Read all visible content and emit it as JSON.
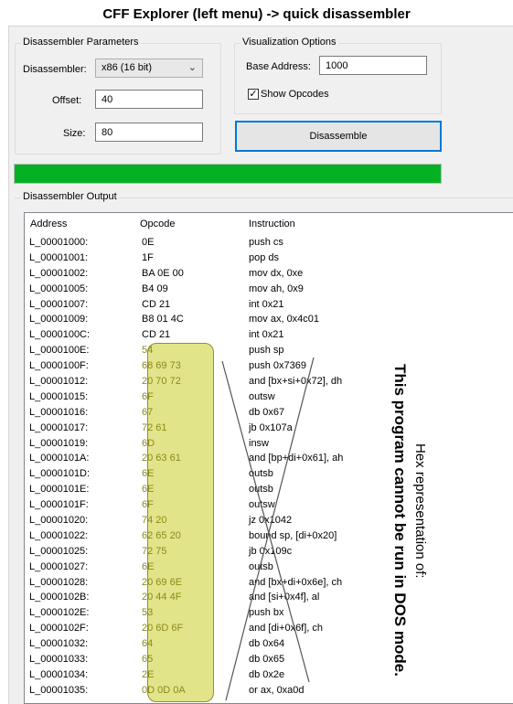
{
  "banner": "CFF Explorer (left menu) -> quick disassembler",
  "disassembler_params": {
    "title": "Disassembler Parameters",
    "disassembler_label": "Disassembler:",
    "disassembler_value": "x86 (16 bit)",
    "offset_label": "Offset:",
    "offset_value": "40",
    "size_label": "Size:",
    "size_value": "80"
  },
  "visualization": {
    "title": "Visualization Options",
    "base_address_label": "Base Address:",
    "base_address_value": "1000",
    "show_opcodes_label": "Show Opcodes",
    "show_opcodes_checked": true
  },
  "disassemble_button": "Disassemble",
  "progress_percent": 100,
  "output": {
    "title": "Disassembler Output",
    "columns": [
      "Address",
      "Opcode",
      "Instruction"
    ],
    "rows": [
      {
        "addr": "L_00001000:",
        "op": "0E",
        "ins": "push cs",
        "hi": false
      },
      {
        "addr": "L_00001001:",
        "op": "1F",
        "ins": "pop ds",
        "hi": false
      },
      {
        "addr": "L_00001002:",
        "op": "BA 0E 00",
        "ins": "mov dx, 0xe",
        "hi": false
      },
      {
        "addr": "L_00001005:",
        "op": "B4 09",
        "ins": "mov ah, 0x9",
        "hi": false
      },
      {
        "addr": "L_00001007:",
        "op": "CD 21",
        "ins": "int 0x21",
        "hi": false
      },
      {
        "addr": "L_00001009:",
        "op": "B8 01 4C",
        "ins": "mov ax, 0x4c01",
        "hi": false
      },
      {
        "addr": "L_0000100C:",
        "op": "CD 21",
        "ins": "int 0x21",
        "hi": false
      },
      {
        "addr": "L_0000100E:",
        "op": "54",
        "ins": "push sp",
        "hi": true
      },
      {
        "addr": "L_0000100F:",
        "op": "68 69 73",
        "ins": "push 0x7369",
        "hi": true
      },
      {
        "addr": "L_00001012:",
        "op": "20 70 72",
        "ins": "and [bx+si+0x72], dh",
        "hi": true
      },
      {
        "addr": "L_00001015:",
        "op": "6F",
        "ins": "outsw",
        "hi": true
      },
      {
        "addr": "L_00001016:",
        "op": "67",
        "ins": "db 0x67",
        "hi": true
      },
      {
        "addr": "L_00001017:",
        "op": "72 61",
        "ins": "jb 0x107a",
        "hi": true
      },
      {
        "addr": "L_00001019:",
        "op": "6D",
        "ins": "insw",
        "hi": true
      },
      {
        "addr": "L_0000101A:",
        "op": "20 63 61",
        "ins": "and [bp+di+0x61], ah",
        "hi": true
      },
      {
        "addr": "L_0000101D:",
        "op": "6E",
        "ins": "outsb",
        "hi": true
      },
      {
        "addr": "L_0000101E:",
        "op": "6E",
        "ins": "outsb",
        "hi": true
      },
      {
        "addr": "L_0000101F:",
        "op": "6F",
        "ins": "outsw",
        "hi": true
      },
      {
        "addr": "L_00001020:",
        "op": "74 20",
        "ins": "jz 0x1042",
        "hi": true
      },
      {
        "addr": "L_00001022:",
        "op": "62 65 20",
        "ins": "bound sp, [di+0x20]",
        "hi": true
      },
      {
        "addr": "L_00001025:",
        "op": "72 75",
        "ins": "jb 0x109c",
        "hi": true
      },
      {
        "addr": "L_00001027:",
        "op": "6E",
        "ins": "outsb",
        "hi": true
      },
      {
        "addr": "L_00001028:",
        "op": "20 69 6E",
        "ins": "and [bx+di+0x6e], ch",
        "hi": true
      },
      {
        "addr": "L_0000102B:",
        "op": "20 44 4F",
        "ins": "and [si+0x4f], al",
        "hi": true
      },
      {
        "addr": "L_0000102E:",
        "op": "53",
        "ins": "push bx",
        "hi": true
      },
      {
        "addr": "L_0000102F:",
        "op": "20 6D 6F",
        "ins": "and [di+0x6f], ch",
        "hi": true
      },
      {
        "addr": "L_00001032:",
        "op": "64",
        "ins": "db 0x64",
        "hi": true
      },
      {
        "addr": "L_00001033:",
        "op": "65",
        "ins": "db 0x65",
        "hi": true
      },
      {
        "addr": "L_00001034:",
        "op": "2E",
        "ins": "db 0x2e",
        "hi": true
      },
      {
        "addr": "L_00001035:",
        "op": "0D 0D 0A",
        "ins": "or ax, 0xa0d",
        "hi": true
      }
    ]
  },
  "annotation": {
    "message": "This program cannot be run in DOS mode.",
    "caption": "Hex representation of:"
  },
  "colors": {
    "progress_fill": "#06b025",
    "highlight_fill": "#e2e48a",
    "button_border": "#0078d7"
  }
}
